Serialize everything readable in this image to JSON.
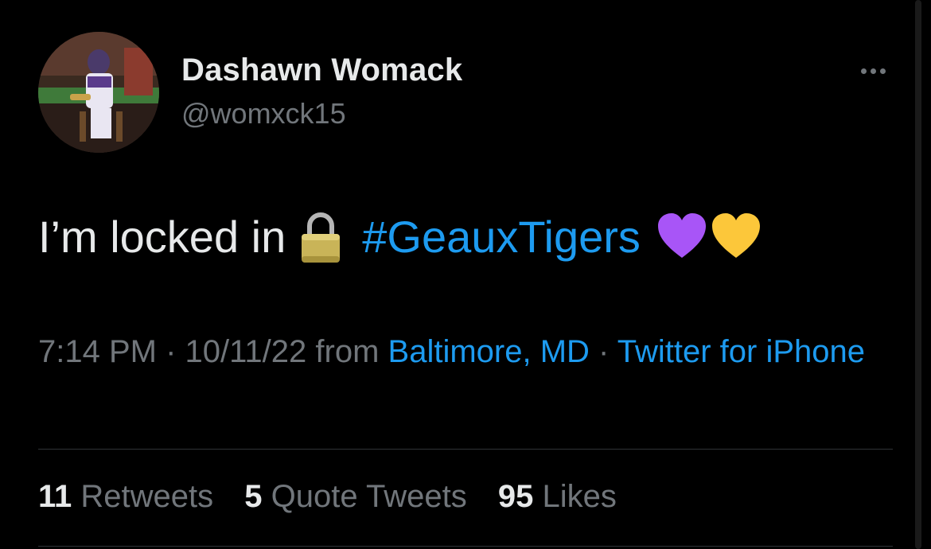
{
  "author": {
    "display_name": "Dashawn Womack",
    "handle": "@womxck15",
    "avatar_icon": "profile-photo"
  },
  "tweet": {
    "text_before": "I’m locked in",
    "lock_emoji": "🔒",
    "hashtag": "#GeauxTigers",
    "heart_purple": "💜",
    "heart_yellow": "💛"
  },
  "meta": {
    "time": "7:14 PM",
    "separator": "·",
    "date": "10/11/22",
    "from_label": "from",
    "location": "Baltimore, MD",
    "source": "Twitter for iPhone"
  },
  "stats": {
    "retweets_count": "11",
    "retweets_label": "Retweets",
    "quotes_count": "5",
    "quotes_label": "Quote Tweets",
    "likes_count": "95",
    "likes_label": "Likes"
  },
  "colors": {
    "background": "#000000",
    "text": "#e7e9ea",
    "secondary": "#71767b",
    "link": "#1d9bf0",
    "purple_heart": "#a855f7",
    "yellow_heart": "#fcc73a"
  },
  "icons": {
    "more": "more-icon",
    "lock": "lock-icon",
    "heart_purple": "purple-heart-icon",
    "heart_yellow": "yellow-heart-icon"
  }
}
